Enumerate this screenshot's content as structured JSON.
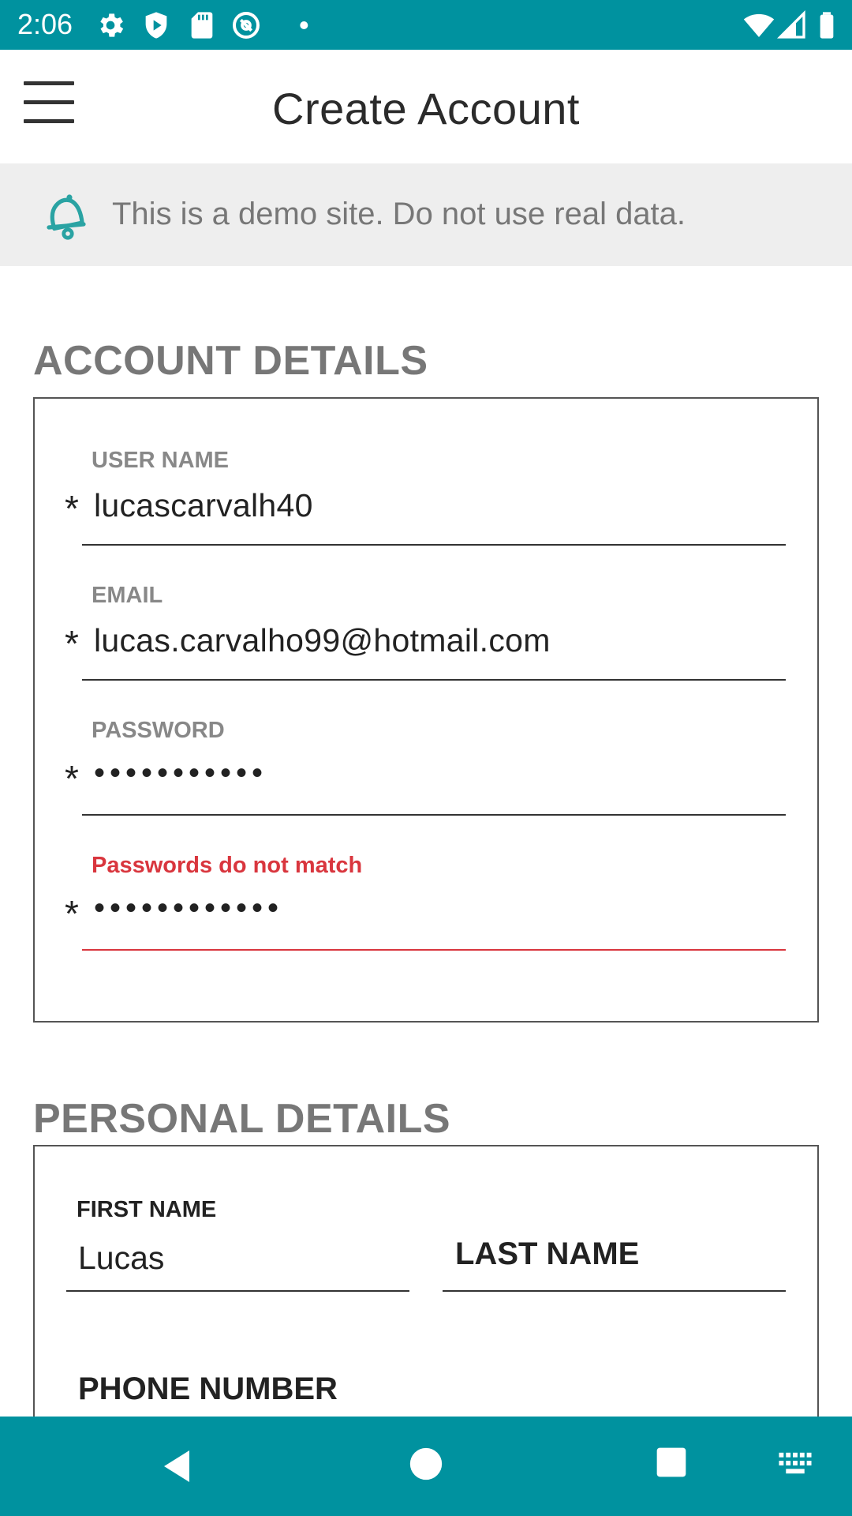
{
  "status_bar": {
    "time": "2:06",
    "icons_left": [
      "settings-icon",
      "shield-play-icon",
      "sd-card-icon",
      "at-sign-icon",
      "dot-icon"
    ],
    "icons_right": [
      "wifi-icon",
      "signal-icon",
      "battery-icon"
    ]
  },
  "app_bar": {
    "title": "Create Account",
    "menu_icon": "hamburger-menu-icon"
  },
  "notice": {
    "icon": "bell-icon",
    "text": "This is a demo site. Do not use real data."
  },
  "account_details": {
    "title": "ACCOUNT DETAILS",
    "fields": [
      {
        "label": "USER NAME",
        "required": "*",
        "value": "lucascarvalh40",
        "error": false
      },
      {
        "label": "EMAIL",
        "required": "*",
        "value": "lucas.carvalho99@hotmail.com",
        "error": false
      },
      {
        "label": "PASSWORD",
        "required": "*",
        "value": "•••••••••••",
        "error": false
      },
      {
        "label": "Passwords do not match",
        "required": "*",
        "value": "••••••••••••",
        "error": true
      }
    ]
  },
  "personal_details": {
    "title": "PERSONAL DETAILS",
    "first_name": {
      "label": "FIRST NAME",
      "value": "Lucas"
    },
    "last_name": {
      "placeholder": "LAST NAME"
    },
    "phone_number": {
      "placeholder": "PHONE NUMBER"
    }
  },
  "nav_bar": {
    "icons": [
      "back-icon",
      "home-icon",
      "recents-icon",
      "keyboard-icon"
    ]
  },
  "colors": {
    "accent": "#00929f",
    "error": "#d9363e",
    "section_gray": "#777777"
  }
}
